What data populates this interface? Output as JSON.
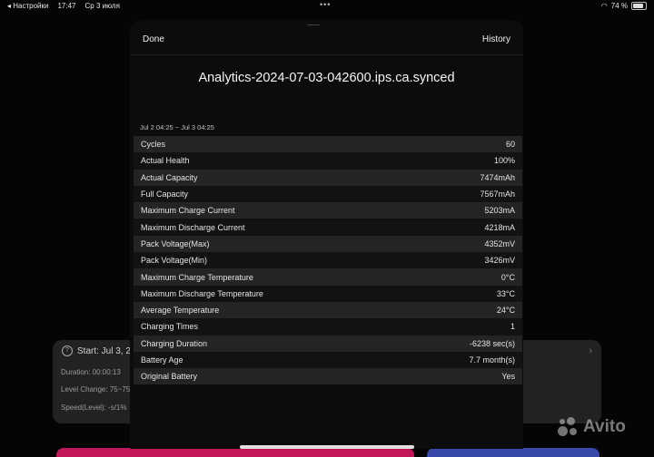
{
  "status": {
    "back_label": "◂ Настройки",
    "time": "17:47",
    "date": "Ср 3 июля",
    "dots": "•••",
    "battery_percent": "74 %",
    "battery_level": 0.74
  },
  "background_card": {
    "start": "Start: Jul 3, 20",
    "duration": "Duration: 00:00:13",
    "level_change": "Level Change: 75~75",
    "speed": "Speed(Level): -s/1%"
  },
  "modal": {
    "done_label": "Done",
    "history_label": "History",
    "title": "Analytics-2024-07-03-042600.ips.ca.synced",
    "date_range": "Jul 2 04:25 ~ Jul 3 04:25",
    "rows": [
      {
        "label": "Cycles",
        "value": "60"
      },
      {
        "label": "Actual Health",
        "value": "100%"
      },
      {
        "label": "Actual Capacity",
        "value": "7474mAh"
      },
      {
        "label": "Full Capacity",
        "value": "7567mAh"
      },
      {
        "label": "Maximum Charge Current",
        "value": "5203mA"
      },
      {
        "label": "Maximum Discharge Current",
        "value": "4218mA"
      },
      {
        "label": "Pack Voltage(Max)",
        "value": "4352mV"
      },
      {
        "label": "Pack Voltage(Min)",
        "value": "3426mV"
      },
      {
        "label": "Maximum Charge Temperature",
        "value": "0°C"
      },
      {
        "label": "Maximum Discharge Temperature",
        "value": "33°C"
      },
      {
        "label": "Average Temperature",
        "value": "24°C"
      },
      {
        "label": "Charging Times",
        "value": "1"
      },
      {
        "label": "Charging Duration",
        "value": "-6238 sec(s)"
      },
      {
        "label": "Battery Age",
        "value": "7.7 month(s)"
      },
      {
        "label": "Original Battery",
        "value": "Yes"
      }
    ]
  },
  "watermark": {
    "text": "Avito"
  },
  "colors": {
    "accent_pink": "#c2185b",
    "accent_blue": "#3949ab"
  }
}
